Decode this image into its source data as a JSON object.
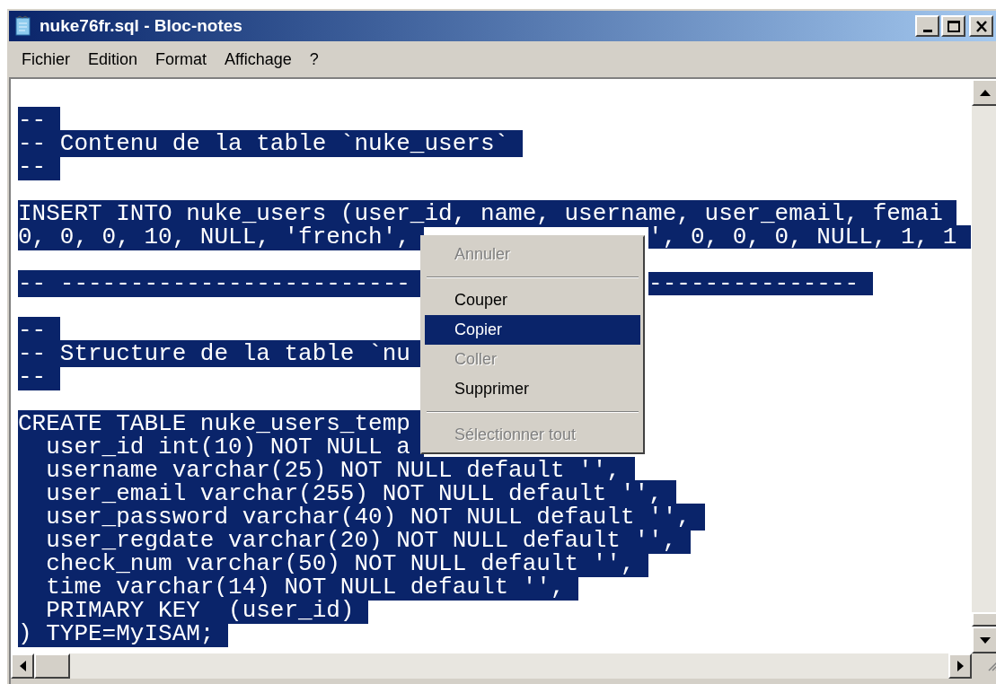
{
  "window": {
    "title": "nuke76fr.sql - Bloc-notes"
  },
  "menu_bar": [
    "Fichier",
    "Edition",
    "Format",
    "Affichage",
    "?"
  ],
  "editor": {
    "lines": [
      {
        "kind": "blank"
      },
      {
        "kind": "text",
        "text": "--",
        "selected": true
      },
      {
        "kind": "text",
        "text": "-- Contenu de la table `nuke_users`",
        "selected": true
      },
      {
        "kind": "text",
        "text": "--",
        "selected": true
      },
      {
        "kind": "blank"
      },
      {
        "kind": "text",
        "text": "INSERT INTO nuke_users (user_id, name, username, user_email, femai",
        "selected": true
      },
      {
        "kind": "text",
        "text": "0, 0, 0, 10, NULL, 'french',",
        "after_menu": "', 0, 0, 0, NULL, 1, 1",
        "selected": true
      },
      {
        "kind": "blank"
      },
      {
        "kind": "text",
        "text": "-- -------------------------",
        "after_menu": "---------------",
        "selected": true
      },
      {
        "kind": "blank"
      },
      {
        "kind": "text",
        "text": "--",
        "selected": true
      },
      {
        "kind": "text",
        "text": "-- Structure de la table `nu",
        "selected": true
      },
      {
        "kind": "text",
        "text": "--",
        "selected": true
      },
      {
        "kind": "blank"
      },
      {
        "kind": "text",
        "text": "CREATE TABLE nuke_users_temp",
        "selected": true
      },
      {
        "kind": "text",
        "text": "  user_id int(10) NOT NULL a",
        "selected": true
      },
      {
        "kind": "text",
        "text": "  username varchar(25) NOT NULL default '',",
        "selected": true
      },
      {
        "kind": "text",
        "text": "  user_email varchar(255) NOT NULL default '',",
        "selected": true
      },
      {
        "kind": "text",
        "text": "  user_password varchar(40) NOT NULL default '',",
        "selected": true
      },
      {
        "kind": "text",
        "text": "  user_regdate varchar(20) NOT NULL default '',",
        "selected": true
      },
      {
        "kind": "text",
        "text": "  check_num varchar(50) NOT NULL default '',",
        "selected": true
      },
      {
        "kind": "text",
        "text": "  time varchar(14) NOT NULL default '',",
        "selected": true
      },
      {
        "kind": "text",
        "text": "  PRIMARY KEY  (user_id)",
        "selected": true
      },
      {
        "kind": "text",
        "text": ") TYPE=MyISAM;",
        "selected": true
      }
    ]
  },
  "context_menu": {
    "items": [
      {
        "kind": "item",
        "label": "Annuler",
        "disabled": true,
        "selected": false
      },
      {
        "kind": "separator"
      },
      {
        "kind": "item",
        "label": "Couper",
        "disabled": false,
        "selected": false
      },
      {
        "kind": "item",
        "label": "Copier",
        "disabled": false,
        "selected": true
      },
      {
        "kind": "item",
        "label": "Coller",
        "disabled": true,
        "selected": false
      },
      {
        "kind": "item",
        "label": "Supprimer",
        "disabled": false,
        "selected": false
      },
      {
        "kind": "separator"
      },
      {
        "kind": "item",
        "label": "Sélectionner tout",
        "disabled": true,
        "selected": false
      }
    ]
  }
}
